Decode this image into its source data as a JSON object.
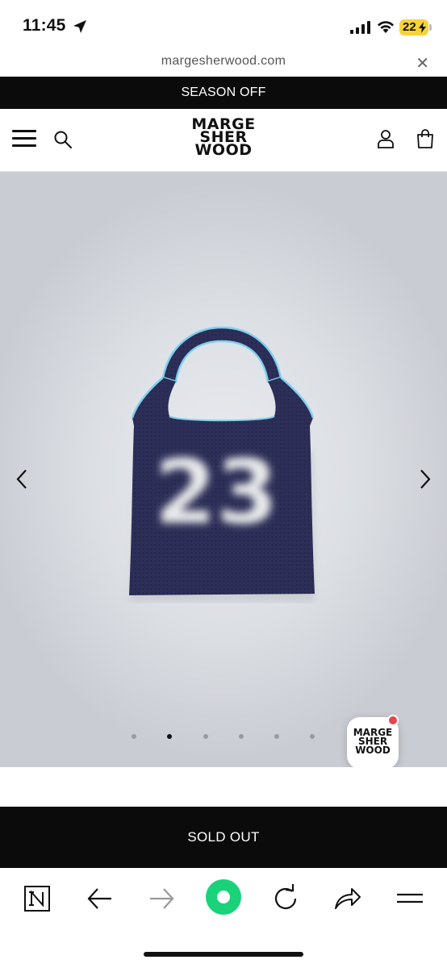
{
  "status_bar": {
    "time": "11:45",
    "battery": "22"
  },
  "browser": {
    "url": "margesherwood.com"
  },
  "promo_banner": {
    "text": "SEASON OFF"
  },
  "header": {
    "logo_lines": [
      "MARGE",
      "SHER",
      "WOOD"
    ]
  },
  "gallery": {
    "slide_count": 6,
    "active_slide": 2,
    "product_number": "23"
  },
  "chat_badge": {
    "logo_lines": [
      "MARGE",
      "SHER",
      "WOOD"
    ]
  },
  "purchase": {
    "button_label": "SOLD OUT"
  },
  "colors": {
    "banner_bg": "#0b0b0b",
    "bag_navy": "#2d2f58",
    "bag_trim": "#7fd0ee",
    "refresh_accent": "#19d27a",
    "notify_dot": "#e8434f"
  },
  "toolbar_icons": [
    "notion-n-icon",
    "back-arrow-icon",
    "forward-arrow-icon",
    "home-circle-icon",
    "refresh-icon",
    "share-icon",
    "menu-lines-icon"
  ]
}
